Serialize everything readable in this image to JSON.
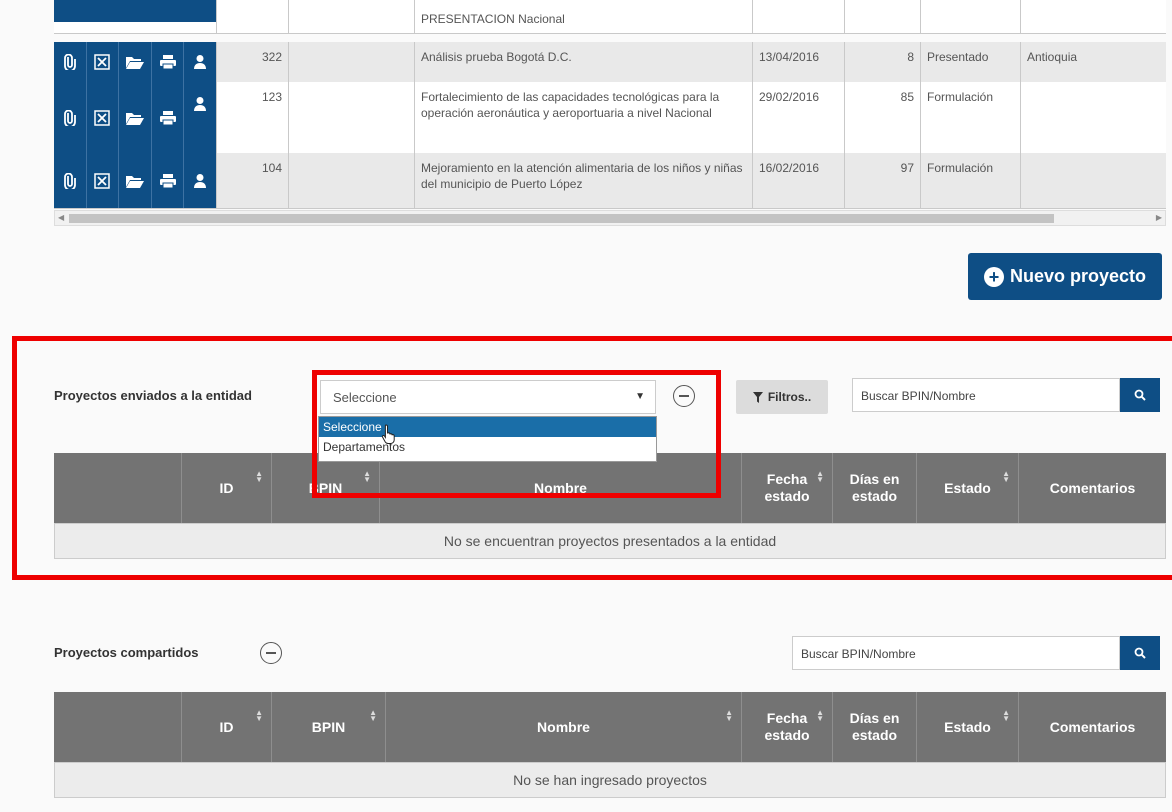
{
  "top_table": {
    "rows": [
      {
        "id": "",
        "bpin": "",
        "nombre": "PRESENTACION  Nacional",
        "fecha": "",
        "dias": "",
        "estado": "",
        "departamento": ""
      },
      {
        "id": "322",
        "bpin": "",
        "nombre": "Análisis prueba  Bogotá D.C.",
        "fecha": "13/04/2016",
        "dias": "8",
        "estado": "Presentado",
        "departamento": "Antioquia"
      },
      {
        "id": "123",
        "bpin": "",
        "nombre": "Fortalecimiento de las capacidades tecnológicas para la operación aeronáutica y aeroportuaria a nivel Nacional",
        "fecha": "29/02/2016",
        "dias": "85",
        "estado": "Formulación",
        "departamento": ""
      },
      {
        "id": "104",
        "bpin": "",
        "nombre": "Mejoramiento en la atención alimentaria de los niños y niñas del municipio de  Puerto López",
        "fecha": "16/02/2016",
        "dias": "97",
        "estado": "Formulación",
        "departamento": ""
      }
    ],
    "action_icons": [
      "paperclip-icon",
      "x-box-icon",
      "folder-open-icon",
      "print-icon",
      "user-icon"
    ]
  },
  "nuevo_proyecto": {
    "label": "Nuevo proyecto"
  },
  "enviados": {
    "title": "Proyectos enviados a la entidad",
    "select_value": "Seleccione",
    "dropdown_options": [
      "Seleccione",
      "Departamentos"
    ],
    "filtros_label": "Filtros..",
    "search_placeholder": "Buscar BPIN/Nombre",
    "empty_message": "No se encuentran proyectos presentados a la entidad"
  },
  "compartidos": {
    "title": "Proyectos compartidos",
    "search_placeholder": "Buscar BPIN/Nombre",
    "empty_message": "No se han ingresado proyectos"
  },
  "columns": {
    "id": "ID",
    "bpin": "BPIN",
    "nombre": "Nombre",
    "fecha_1": "Fecha",
    "fecha_2": "estado",
    "dias_1": "Días en",
    "dias_2": "estado",
    "estado": "Estado",
    "comentarios": "Comentarios"
  },
  "colors": {
    "primary": "#0e4e85",
    "highlight_box": "#ee0000",
    "header_bg": "#737373"
  }
}
